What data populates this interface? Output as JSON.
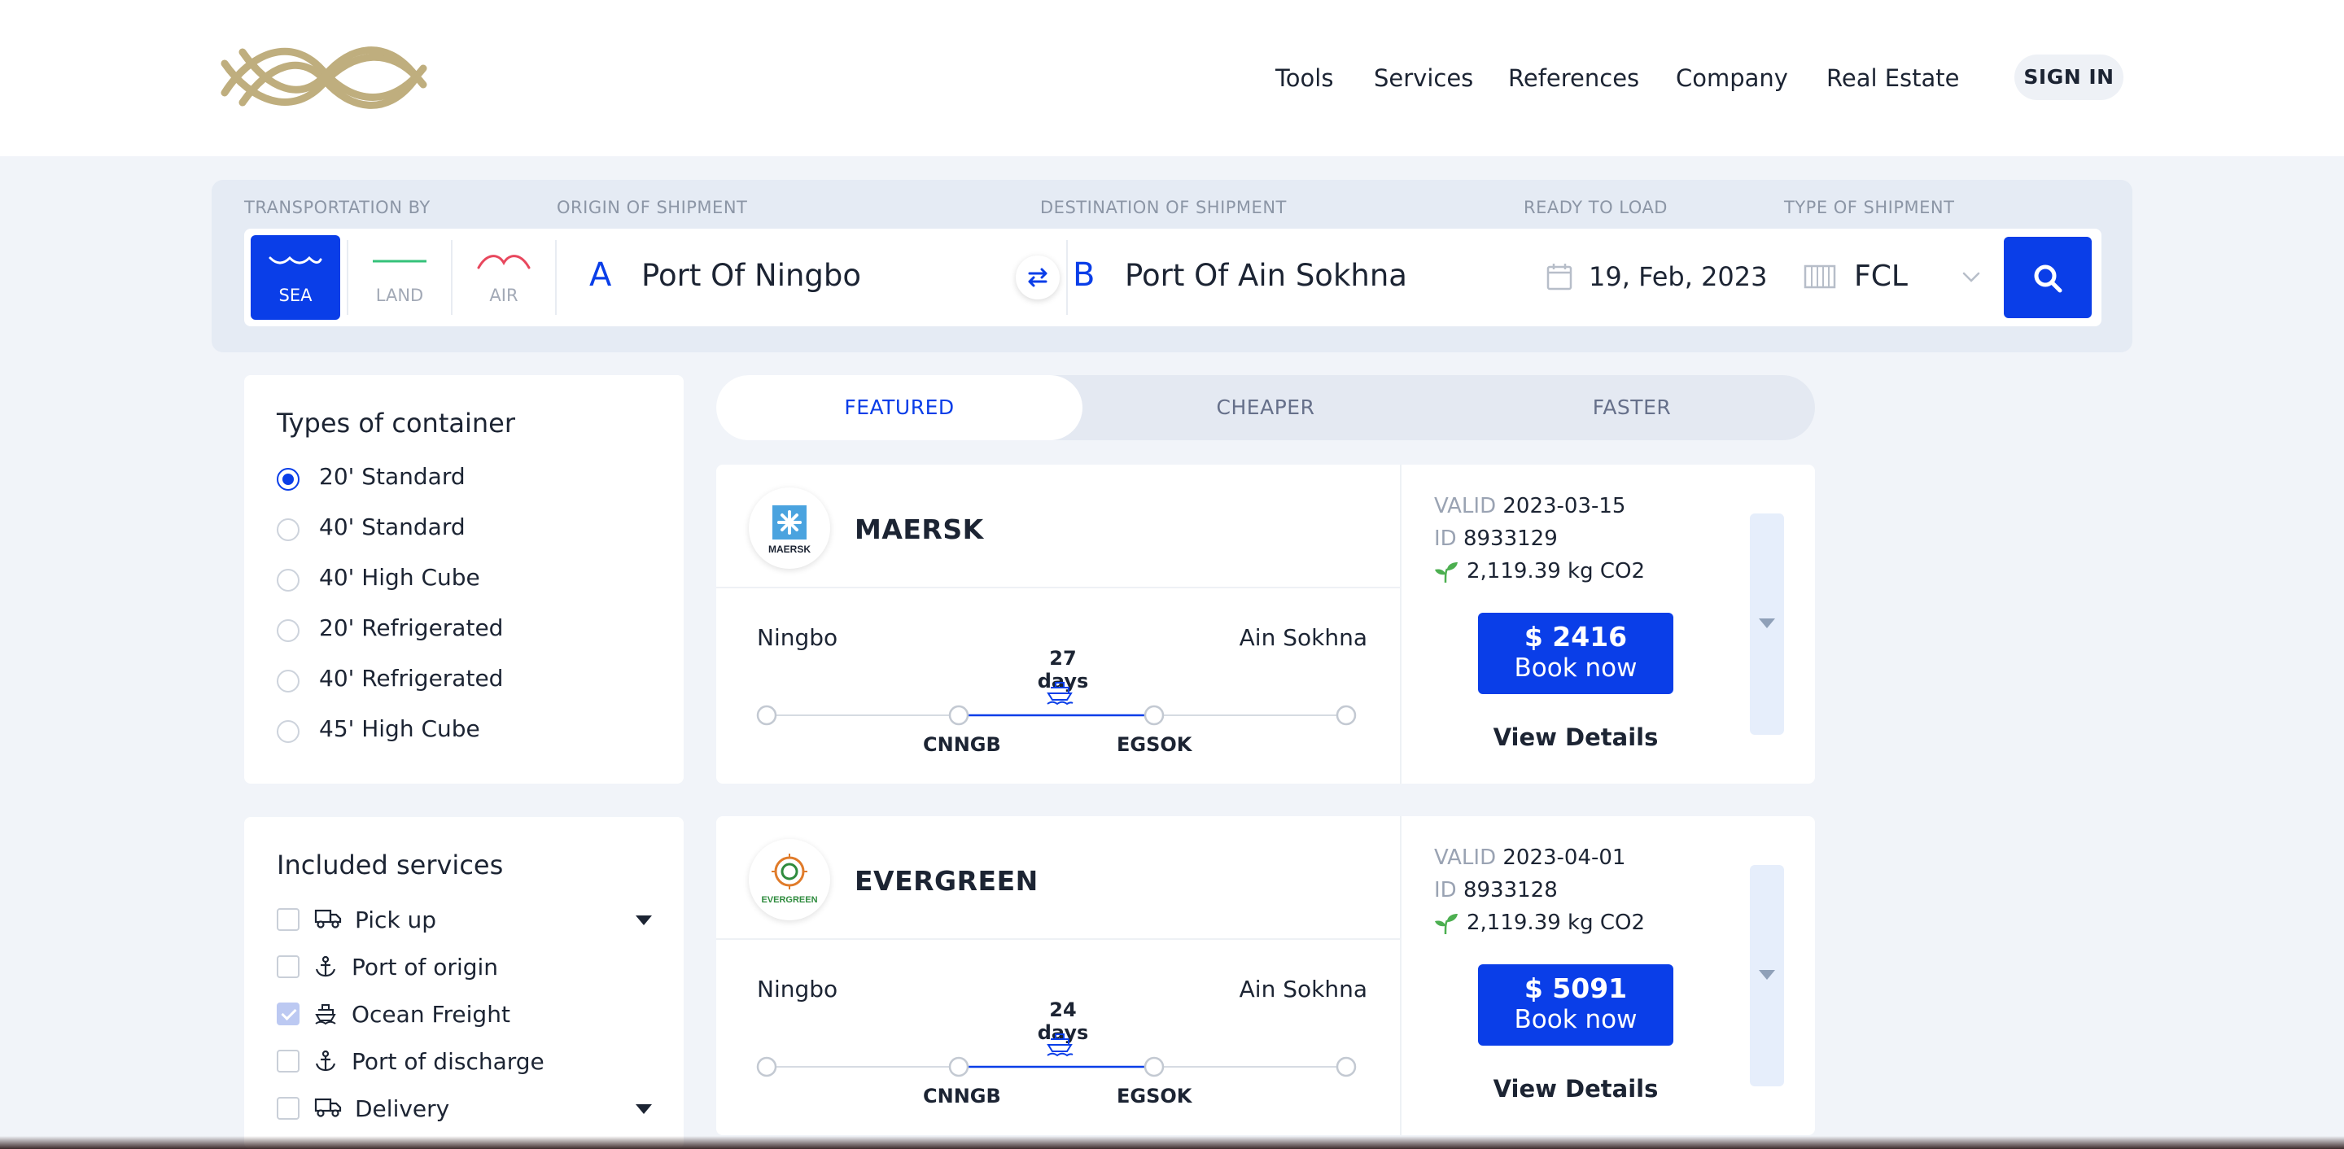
{
  "brand": {
    "logo_name": "infinity-logo",
    "accent": "#0a3ee8",
    "gold": "#bfae7e"
  },
  "nav": {
    "items": [
      "Tools",
      "Services",
      "References",
      "Company",
      "Real Estate"
    ],
    "sign_in": "SIGN IN"
  },
  "search": {
    "labels": {
      "transport": "TRANSPORTATION BY",
      "origin": "ORIGIN OF SHIPMENT",
      "destination": "DESTINATION OF SHIPMENT",
      "ready": "READY TO LOAD",
      "type": "TYPE OF SHIPMENT"
    },
    "modes": [
      {
        "label": "SEA",
        "active": true,
        "icon": "waves-icon"
      },
      {
        "label": "LAND",
        "active": false,
        "icon": "road-icon"
      },
      {
        "label": "AIR",
        "active": false,
        "icon": "wings-icon"
      }
    ],
    "origin": {
      "letter": "A",
      "value": "Port Of Ningbo"
    },
    "destination": {
      "letter": "B",
      "value": "Port Of Ain Sokhna"
    },
    "date": "19, Feb, 2023",
    "shipment_type": "FCL"
  },
  "filters": {
    "container": {
      "title": "Types of container",
      "options": [
        {
          "label": "20' Standard",
          "checked": true
        },
        {
          "label": "40' Standard",
          "checked": false
        },
        {
          "label": "40' High Cube",
          "checked": false
        },
        {
          "label": "20' Refrigerated",
          "checked": false
        },
        {
          "label": "40' Refrigerated",
          "checked": false
        },
        {
          "label": "45' High Cube",
          "checked": false
        }
      ]
    },
    "services": {
      "title": "Included services",
      "items": [
        {
          "label": "Pick up",
          "checked": false,
          "icon": "truck-icon",
          "expandable": true
        },
        {
          "label": "Port of origin",
          "checked": false,
          "icon": "anchor-icon",
          "expandable": false
        },
        {
          "label": "Ocean Freight",
          "checked": true,
          "icon": "ship-icon",
          "expandable": false
        },
        {
          "label": "Port of discharge",
          "checked": false,
          "icon": "anchor-icon",
          "expandable": false
        },
        {
          "label": "Delivery",
          "checked": false,
          "icon": "truck-icon",
          "expandable": true
        }
      ]
    }
  },
  "tabs": [
    {
      "label": "FEATURED",
      "active": true
    },
    {
      "label": "CHEAPER",
      "active": false
    },
    {
      "label": "FASTER",
      "active": false
    }
  ],
  "results": [
    {
      "carrier": "MAERSK",
      "logo_text": "MAERSK",
      "from": "Ningbo",
      "to": "Ain Sokhna",
      "days": "27 days",
      "from_code": "CNNGB",
      "to_code": "EGSOK",
      "valid_label": "VALID",
      "valid": "2023-03-15",
      "id_label": "ID",
      "id": "8933129",
      "co2": "2,119.39 kg CO2",
      "price": "$ 2416",
      "book": "Book now",
      "details": "View Details"
    },
    {
      "carrier": "EVERGREEN",
      "logo_text": "EVERGREEN",
      "from": "Ningbo",
      "to": "Ain Sokhna",
      "days": "24 days",
      "from_code": "CNNGB",
      "to_code": "EGSOK",
      "valid_label": "VALID",
      "valid": "2023-04-01",
      "id_label": "ID",
      "id": "8933128",
      "co2": "2,119.39 kg CO2",
      "price": "$ 5091",
      "book": "Book now",
      "details": "View Details"
    }
  ]
}
